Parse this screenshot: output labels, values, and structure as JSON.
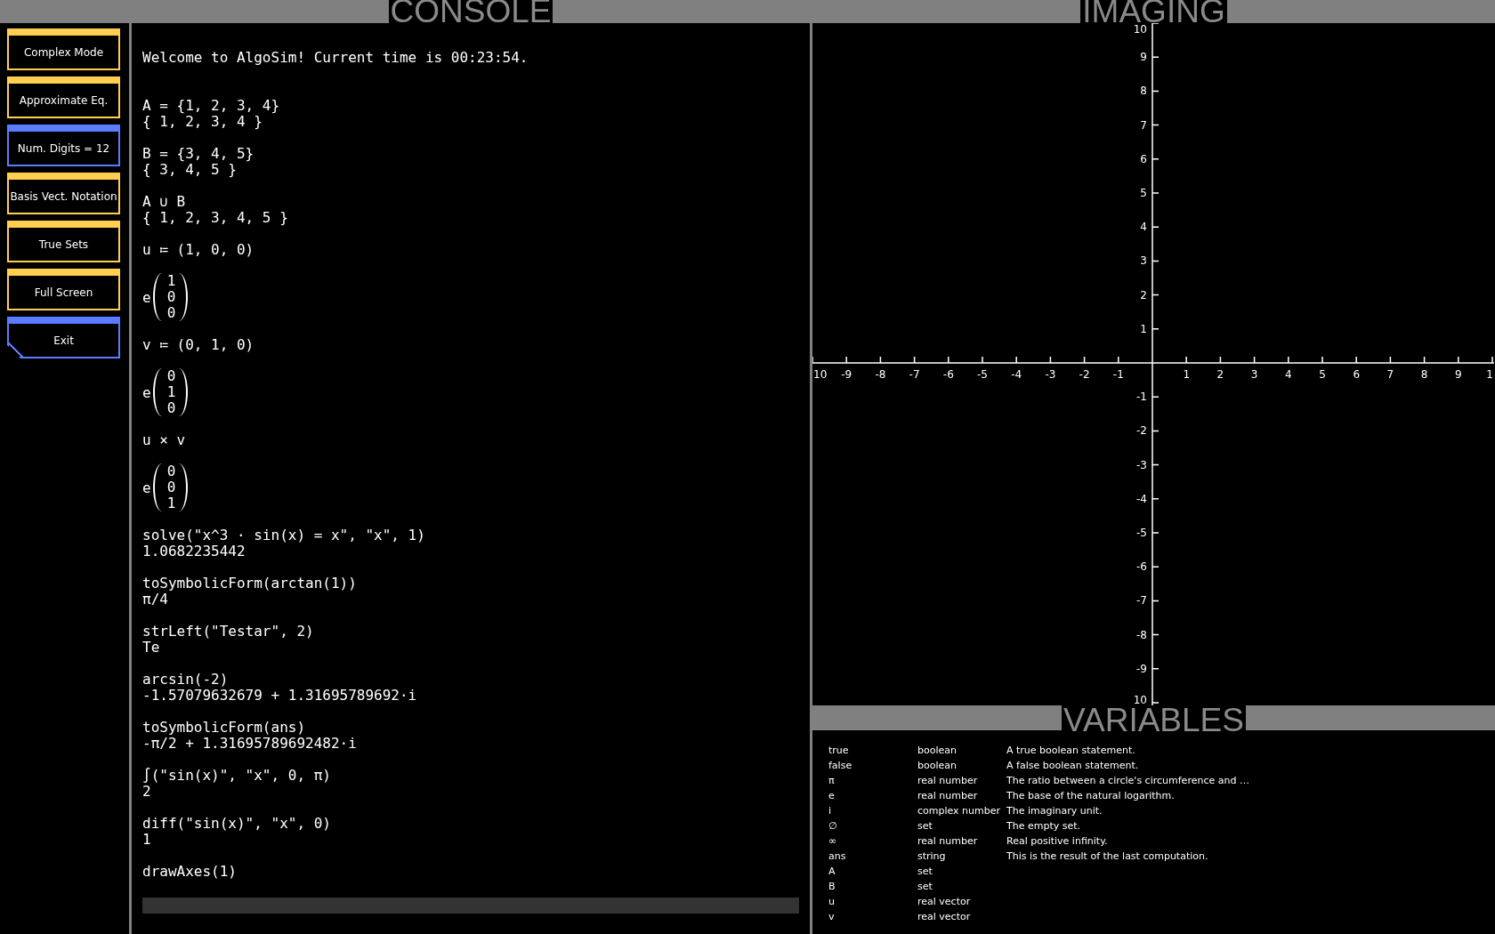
{
  "sidebar": {
    "buttons": [
      {
        "label": "Complex Mode",
        "kind": "toggle"
      },
      {
        "label": "Approximate Eq.",
        "kind": "toggle"
      },
      {
        "label": "Num. Digits = 12",
        "kind": "setting"
      },
      {
        "label": "Basis Vect. Notation",
        "kind": "toggle"
      },
      {
        "label": "True Sets",
        "kind": "toggle"
      },
      {
        "label": "Full Screen",
        "kind": "toggle"
      },
      {
        "label": "Exit",
        "kind": "exit"
      }
    ]
  },
  "console": {
    "title": "CONSOLE",
    "welcome": "Welcome to AlgoSim! Current time is 00:23:54.",
    "entries": [
      {
        "input": "A = {1, 2, 3, 4}",
        "output": {
          "kind": "text",
          "text": "{ 1, 2, 3, 4 }"
        }
      },
      {
        "input": "B = {3, 4, 5}",
        "output": {
          "kind": "text",
          "text": "{ 3, 4, 5 }"
        }
      },
      {
        "input": "A ∪ B",
        "output": {
          "kind": "text",
          "text": "{ 1, 2, 3, 4, 5 }"
        }
      },
      {
        "input": "u ≔ (1, 0, 0)",
        "output": {
          "kind": "vector",
          "prefix": "e",
          "components": [
            "1",
            "0",
            "0"
          ]
        }
      },
      {
        "input": "v ≔ (0, 1, 0)",
        "output": {
          "kind": "vector",
          "prefix": "e",
          "components": [
            "0",
            "1",
            "0"
          ]
        }
      },
      {
        "input": "u × v",
        "output": {
          "kind": "vector",
          "prefix": "e",
          "components": [
            "0",
            "0",
            "1"
          ]
        }
      },
      {
        "input": "solve(\"x^3 · sin(x) = x\", \"x\", 1)",
        "output": {
          "kind": "text",
          "text": "1.0682235442"
        }
      },
      {
        "input": "toSymbolicForm(arctan(1))",
        "output": {
          "kind": "text",
          "text": "π/4"
        }
      },
      {
        "input": "strLeft(\"Testar\", 2)",
        "output": {
          "kind": "text",
          "text": "Te"
        }
      },
      {
        "input": "arcsin(-2)",
        "output": {
          "kind": "text",
          "text": "-1.57079632679 + 1.31695789692·i"
        }
      },
      {
        "input": "toSymbolicForm(ans)",
        "output": {
          "kind": "text",
          "text": "-π/2 + 1.31695789692482·i"
        }
      },
      {
        "input": "∫(\"sin(x)\", \"x\", 0, π)",
        "output": {
          "kind": "text",
          "text": "2"
        }
      },
      {
        "input": "diff(\"sin(x)\", \"x\", 0)",
        "output": {
          "kind": "text",
          "text": "1"
        }
      },
      {
        "input": "drawAxes(1)"
      }
    ]
  },
  "imaging": {
    "title": "IMAGING",
    "x_labels": [
      "10",
      "-9",
      "-8",
      "-7",
      "-6",
      "-5",
      "-4",
      "-3",
      "-2",
      "-1",
      "1",
      "2",
      "3",
      "4",
      "5",
      "6",
      "7",
      "8",
      "9",
      "1"
    ],
    "y_labels": [
      "10",
      "9",
      "8",
      "7",
      "6",
      "5",
      "4",
      "3",
      "2",
      "1",
      "-1",
      "-2",
      "-3",
      "-4",
      "-5",
      "-6",
      "-7",
      "-8",
      "-9",
      "10"
    ]
  },
  "variables": {
    "title": "VARIABLES",
    "rows": [
      {
        "name": "true",
        "type": "boolean",
        "description": "A true boolean statement."
      },
      {
        "name": "false",
        "type": "boolean",
        "description": "A false boolean statement."
      },
      {
        "name": "π",
        "type": "real number",
        "description": "The ratio between a circle's circumference and …"
      },
      {
        "name": "e",
        "type": "real number",
        "description": "The base of the natural logarithm."
      },
      {
        "name": "i",
        "type": "complex number",
        "description": "The imaginary unit."
      },
      {
        "name": "∅",
        "type": "set",
        "description": "The empty set."
      },
      {
        "name": "∞",
        "type": "real number",
        "description": "Real positive infinity."
      },
      {
        "name": "ans",
        "type": "string",
        "description": "This is the result of the last computation."
      },
      {
        "name": "A",
        "type": "set"
      },
      {
        "name": "B",
        "type": "set"
      },
      {
        "name": "u",
        "type": "real vector"
      },
      {
        "name": "v",
        "type": "real vector"
      }
    ]
  }
}
